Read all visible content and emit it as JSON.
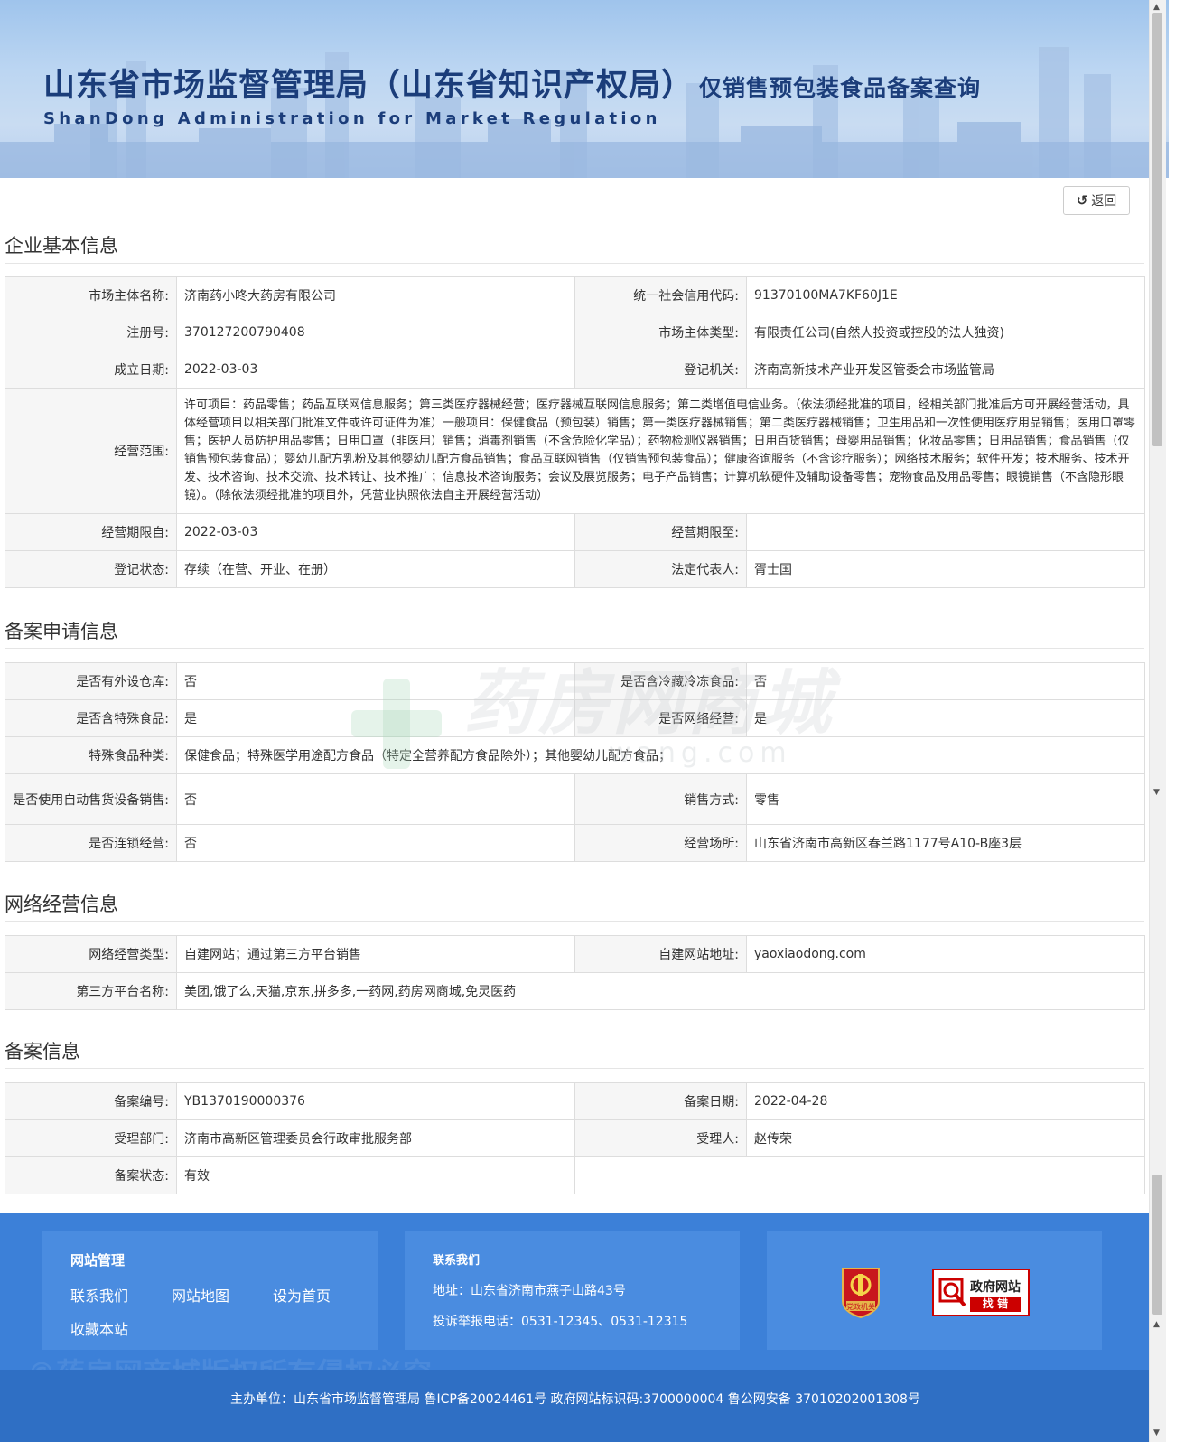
{
  "header": {
    "title_main": "山东省市场监督管理局（山东省知识产权局）",
    "title_sub": "仅销售预包装食品备案查询",
    "title_en": "ShanDong Administration for Market Regulation"
  },
  "back_button": {
    "label": "返回",
    "icon": "undo-icon"
  },
  "sections": {
    "basic": {
      "title": "企业基本信息",
      "rows": [
        {
          "l1": "市场主体名称:",
          "v1": "济南药小咚大药房有限公司",
          "l2": "统一社会信用代码:",
          "v2": "91370100MA7KF60J1E"
        },
        {
          "l1": "注册号:",
          "v1": "370127200790408",
          "l2": "市场主体类型:",
          "v2": "有限责任公司(自然人投资或控股的法人独资)"
        },
        {
          "l1": "成立日期:",
          "v1": "2022-03-03",
          "l2": "登记机关:",
          "v2": "济南高新技术产业开发区管委会市场监管局"
        },
        {
          "l1": "经营范围:",
          "v1": "许可项目：药品零售；药品互联网信息服务；第三类医疗器械经营；医疗器械互联网信息服务；第二类增值电信业务。（依法须经批准的项目，经相关部门批准后方可开展经营活动，具体经营项目以相关部门批准文件或许可证件为准）一般项目：保健食品（预包装）销售；第一类医疗器械销售；第二类医疗器械销售；卫生用品和一次性使用医疗用品销售；医用口罩零售；医护人员防护用品零售；日用口罩（非医用）销售；消毒剂销售（不含危险化学品）；药物检测仪器销售；日用百货销售；母婴用品销售；化妆品零售；日用品销售；食品销售（仅销售预包装食品）；婴幼儿配方乳粉及其他婴幼儿配方食品销售；食品互联网销售（仅销售预包装食品）；健康咨询服务（不含诊疗服务）；网络技术服务；软件开发；技术服务、技术开发、技术咨询、技术交流、技术转让、技术推广；信息技术咨询服务；会议及展览服务；电子产品销售；计算机软硬件及辅助设备零售；宠物食品及用品零售；眼镜销售（不含隐形眼镜）。（除依法须经批准的项目外，凭营业执照依法自主开展经营活动）"
        },
        {
          "l1": "经营期限自:",
          "v1": "2022-03-03",
          "l2": "经营期限至:",
          "v2": ""
        },
        {
          "l1": "登记状态:",
          "v1": "存续（在营、开业、在册）",
          "l2": "法定代表人:",
          "v2": "胥士国"
        }
      ]
    },
    "filing_apply": {
      "title": "备案申请信息",
      "rows": [
        {
          "l1": "是否有外设仓库:",
          "v1": "否",
          "l2": "是否含冷藏冷冻食品:",
          "v2": "否"
        },
        {
          "l1": "是否含特殊食品:",
          "v1": "是",
          "l2": "是否网络经营:",
          "v2": "是"
        },
        {
          "l1": "特殊食品种类:",
          "v1": "保健食品；特殊医学用途配方食品（特定全营养配方食品除外）；其他婴幼儿配方食品；"
        },
        {
          "l1": "是否使用自动售货设备销售:",
          "v1": "否",
          "l2": "销售方式:",
          "v2": "零售"
        },
        {
          "l1": "是否连锁经营:",
          "v1": "否",
          "l2": "经营场所:",
          "v2": "山东省济南市高新区春兰路1177号A10-B座3层"
        }
      ]
    },
    "network": {
      "title": "网络经营信息",
      "rows": [
        {
          "l1": "网络经营类型:",
          "v1": "自建网站；通过第三方平台销售",
          "l2": "自建网站地址:",
          "v2": "yaoxiaodong.com"
        },
        {
          "l1": "第三方平台名称:",
          "v1": "美团,饿了么,天猫,京东,拼多多,一药网,药房网商城,免灵医药"
        }
      ]
    },
    "filing": {
      "title": "备案信息",
      "rows": [
        {
          "l1": "备案编号:",
          "v1": "YB1370190000376",
          "l2": "备案日期:",
          "v2": "2022-04-28"
        },
        {
          "l1": "受理部门:",
          "v1": "济南市高新区管理委员会行政审批服务部",
          "l2": "受理人:",
          "v2": "赵传荣"
        },
        {
          "l1": "备案状态:",
          "v1": "有效",
          "l2": "",
          "v2": ""
        }
      ]
    }
  },
  "watermark": {
    "text": "药房网商城",
    "url": "wang.com"
  },
  "footer": {
    "site_admin": {
      "title": "网站管理",
      "links": [
        "联系我们",
        "网站地图",
        "设为首页",
        "收藏本站"
      ]
    },
    "contact": {
      "title": "联系我们",
      "address": "地址：山东省济南市燕子山路43号",
      "phone": "投诉举报电话：0531-12345、0531-12315"
    },
    "badges": {
      "party": "党政机关",
      "gov_t1": "政府网站",
      "gov_t2": "找 错"
    },
    "copyright_watermark": "©药房网商城版权所有侵权必究",
    "bottom": "主办单位：山东省市场监督管理局 鲁ICP备20024461号    政府网站标识码:3700000004  鲁公网安备 37010202001308号"
  },
  "colors": {
    "footer": "#3c80d8",
    "footer_box": "#4a8ce0",
    "header_text": "#1b3d7a",
    "label_bg": "#f6f6f6"
  }
}
